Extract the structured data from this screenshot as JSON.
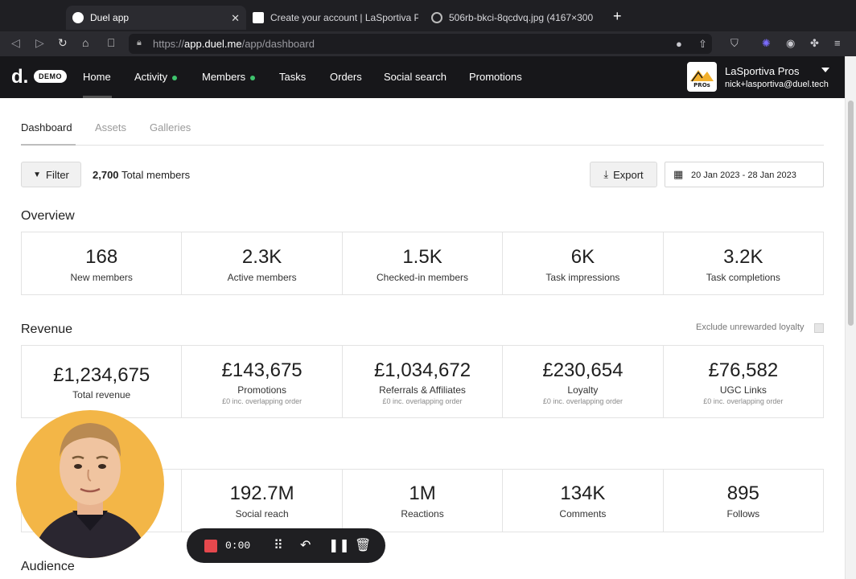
{
  "browser": {
    "tabs": [
      {
        "title": "Duel app"
      },
      {
        "title": "Create your account | LaSportiva Pr"
      },
      {
        "title": "506rb-bkci-8qcdvq.jpg (4167×300"
      }
    ],
    "url_prefix": "https://",
    "url_host": "app.duel.me",
    "url_path": "/app/dashboard"
  },
  "app": {
    "logo": "d.",
    "demo_badge": "DEMO",
    "nav": [
      "Home",
      "Activity",
      "Members",
      "Tasks",
      "Orders",
      "Social search",
      "Promotions"
    ],
    "account": {
      "name": "LaSportiva Pros",
      "email": "nick+lasportiva@duel.tech",
      "avatar_text": "PROs"
    }
  },
  "subtabs": [
    "Dashboard",
    "Assets",
    "Galleries"
  ],
  "filters": {
    "filter_label": "Filter",
    "total_count": "2,700",
    "total_label": "Total members",
    "export_label": "Export",
    "date_range": "20 Jan 2023 - 28 Jan 2023"
  },
  "overview": {
    "title": "Overview",
    "stats": [
      {
        "value": "168",
        "label": "New members"
      },
      {
        "value": "2.3K",
        "label": "Active members"
      },
      {
        "value": "1.5K",
        "label": "Checked-in members"
      },
      {
        "value": "6K",
        "label": "Task impressions"
      },
      {
        "value": "3.2K",
        "label": "Task completions"
      }
    ]
  },
  "revenue": {
    "title": "Revenue",
    "exclude_label": "Exclude unrewarded loyalty",
    "stats": [
      {
        "value": "£1,234,675",
        "label": "Total revenue",
        "sub": ""
      },
      {
        "value": "£143,675",
        "label": "Promotions",
        "sub": "£0 inc. overlapping order"
      },
      {
        "value": "£1,034,672",
        "label": "Referrals & Affiliates",
        "sub": "£0 inc. overlapping order"
      },
      {
        "value": "£230,654",
        "label": "Loyalty",
        "sub": "£0 inc. overlapping order"
      },
      {
        "value": "£76,582",
        "label": "UGC Links",
        "sub": "£0 inc. overlapping order"
      }
    ]
  },
  "social": {
    "stats": [
      {
        "value": "",
        "label": ""
      },
      {
        "value": "192.7M",
        "label": "Social reach"
      },
      {
        "value": "1M",
        "label": "Reactions"
      },
      {
        "value": "134K",
        "label": "Comments"
      },
      {
        "value": "895",
        "label": "Follows"
      }
    ]
  },
  "audience": {
    "title": "Audience"
  },
  "recorder": {
    "time": "0:00"
  }
}
